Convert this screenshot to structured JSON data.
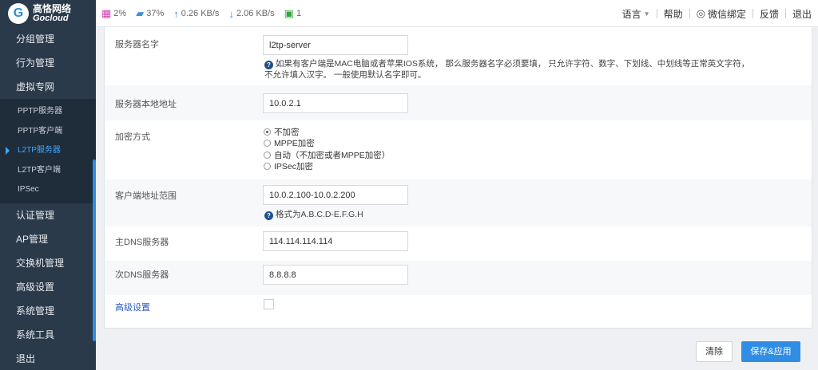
{
  "logo": {
    "mark": "G",
    "cn": "高恪网络",
    "en": "Gocloud"
  },
  "status": {
    "cpu": "2%",
    "memory": "37%",
    "upload": "0.26 KB/s",
    "download": "2.06 KB/s",
    "online_users": "1"
  },
  "topnav": {
    "language": "语言",
    "help": "帮助",
    "wechat": "微信绑定",
    "feedback": "反馈",
    "logout": "退出"
  },
  "sidebar": {
    "items_top": [
      "分组管理",
      "行为管理",
      "虚拟专网"
    ],
    "sub_items": [
      "PPTP服务器",
      "PPTP客户端",
      "L2TP服务器",
      "L2TP客户端",
      "IPSec"
    ],
    "active_sub": "L2TP服务器",
    "items_bottom": [
      "认证管理",
      "AP管理",
      "交换机管理",
      "高级设置",
      "系统管理",
      "系统工具",
      "退出"
    ]
  },
  "form": {
    "server_name": {
      "label": "服务器名字",
      "value": "l2tp-server",
      "hint_line1": "如果有客户端是MAC电脑或者苹果IOS系统， 那么服务器名字必须要填， 只允许字符、数字、下划线、中划线等正常英文字符，",
      "hint_line2": "不允许填入汉字。 一般使用默认名字即可。"
    },
    "local_address": {
      "label": "服务器本地地址",
      "value": "10.0.2.1"
    },
    "encryption": {
      "label": "加密方式",
      "options": [
        "不加密",
        "MPPE加密",
        "自动（不加密或者MPPE加密）",
        "IPSec加密"
      ],
      "selected": "不加密"
    },
    "client_range": {
      "label": "客户端地址范围",
      "value": "10.0.2.100-10.0.2.200",
      "hint": "格式为A.B.C.D-E.F.G.H"
    },
    "primary_dns": {
      "label": "主DNS服务器",
      "value": "114.114.114.114"
    },
    "secondary_dns": {
      "label": "次DNS服务器",
      "value": "8.8.8.8"
    },
    "advanced": {
      "label": "高级设置",
      "checked": false
    }
  },
  "buttons": {
    "clear": "清除",
    "save": "保存&应用"
  },
  "colors": {
    "sidebar_bg": "#2b3a4a",
    "accent": "#2f8de4",
    "link": "#2b5cc3"
  }
}
